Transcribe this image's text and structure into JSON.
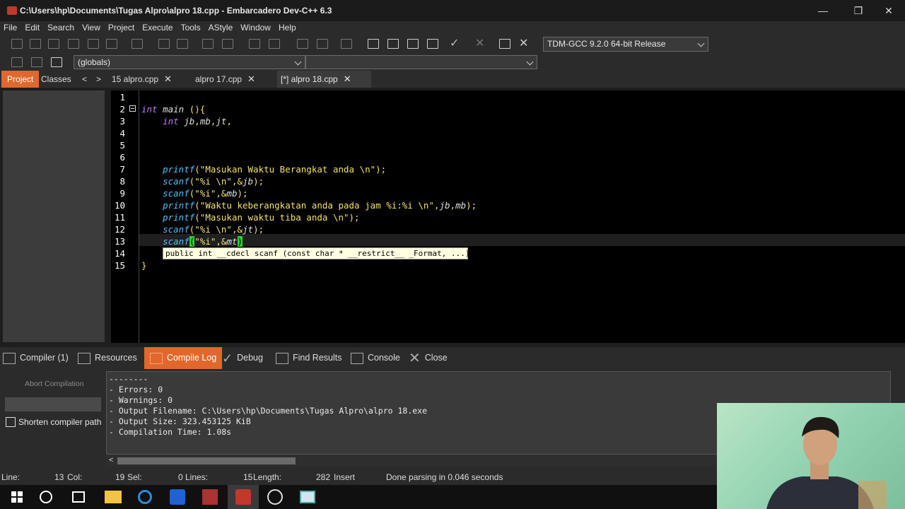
{
  "window": {
    "title": "C:\\Users\\hp\\Documents\\Tugas Alpro\\alpro 18.cpp - Embarcadero Dev-C++ 6.3",
    "minimize": "—",
    "maximize": "❐",
    "close": "✕"
  },
  "menu": [
    "File",
    "Edit",
    "Search",
    "View",
    "Project",
    "Execute",
    "Tools",
    "AStyle",
    "Window",
    "Help"
  ],
  "toolbar": {
    "compiler_select": "TDM-GCC 9.2.0 64-bit Release",
    "scope_select": "(globals)",
    "function_select": ""
  },
  "side_tabs": [
    "Project",
    "Classes"
  ],
  "nav": {
    "prev": "<",
    "next": ">"
  },
  "file_tabs": [
    {
      "label": "15 alpro.cpp",
      "close": "✕"
    },
    {
      "label": "alpro 17.cpp",
      "close": "✕"
    },
    {
      "label": "[*] alpro 18.cpp",
      "close": "✕"
    }
  ],
  "editor": {
    "line_numbers": [
      "1",
      "2",
      "3",
      "4",
      "5",
      "6",
      "7",
      "8",
      "9",
      "10",
      "11",
      "12",
      "13",
      "14",
      "15"
    ],
    "current_line": 13,
    "hint": "public int __cdecl scanf (const char * __restrict__ _Format, ...)"
  },
  "bottom_tabs": {
    "compiler": "Compiler (1)",
    "resources": "Resources",
    "compile_log": "Compile Log",
    "debug": "Debug",
    "find_results": "Find Results",
    "console": "Console",
    "close": "Close"
  },
  "compile_panel": {
    "abort_button": "Abort Compilation",
    "shorten_checkbox": "Shorten compiler path",
    "shorten_checked": false,
    "log": [
      "--------",
      "- Errors: 0",
      "- Warnings: 0",
      "- Output Filename: C:\\Users\\hp\\Documents\\Tugas Alpro\\alpro 18.exe",
      "- Output Size: 323.453125 KiB",
      "- Compilation Time: 1.08s"
    ]
  },
  "status": {
    "line_label": "Line:",
    "line_value": "13",
    "col_label": "Col:",
    "col_value": "19",
    "sel_label": "Sel:",
    "sel_value": "0",
    "lines_label": "Lines:",
    "lines_value": "15",
    "length_label": "Length:",
    "length_value": "282",
    "mode": "Insert",
    "message": "Done parsing in 0.046 seconds"
  },
  "colors": {
    "accent": "#e2672c",
    "keyword": "#b77bf0",
    "function": "#4fc1ff",
    "string": "#f2e16b",
    "bracket_match": "#2bd130"
  }
}
